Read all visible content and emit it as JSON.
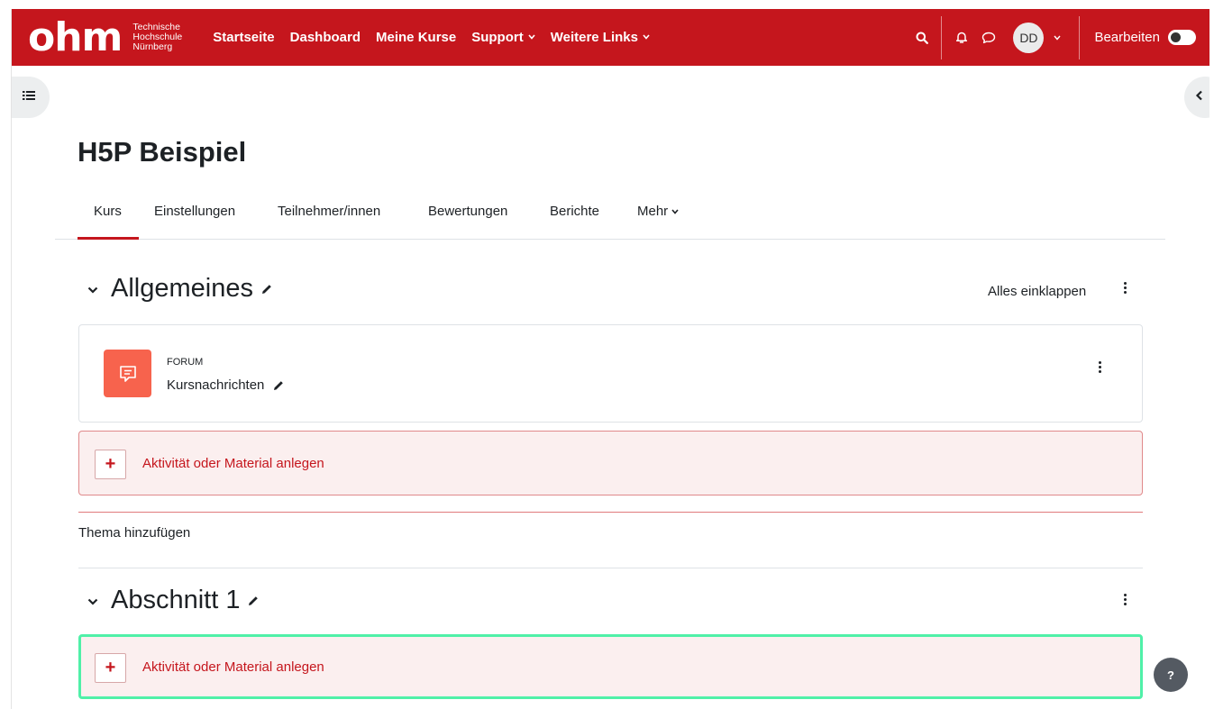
{
  "brand": {
    "logo_word": "ohm",
    "sub_line1": "Technische",
    "sub_line2": "Hochschule",
    "sub_line3": "Nürnberg",
    "color": "#c5161d"
  },
  "nav": {
    "items": [
      {
        "label": "Startseite"
      },
      {
        "label": "Dashboard"
      },
      {
        "label": "Meine Kurse"
      },
      {
        "label": "Support"
      },
      {
        "label": "Weitere Links"
      }
    ],
    "user_initials": "DD",
    "edit_label": "Bearbeiten",
    "edit_mode_on": true
  },
  "course": {
    "title": "H5P Beispiel",
    "tabs": [
      {
        "label": "Kurs",
        "active": true
      },
      {
        "label": "Einstellungen"
      },
      {
        "label": "Teilnehmer/innen"
      },
      {
        "label": "Bewertungen"
      },
      {
        "label": "Berichte"
      },
      {
        "label": "Mehr"
      }
    ],
    "collapse_all": "Alles einklappen"
  },
  "sections": [
    {
      "title": "Allgemeines",
      "activity": {
        "type": "FORUM",
        "name": "Kursnachrichten"
      },
      "add_label": "Aktivität oder Material anlegen"
    },
    {
      "title": "Abschnitt 1",
      "add_label": "Aktivität oder Material anlegen"
    }
  ],
  "add_topic": "Thema hinzufügen",
  "help": "?"
}
